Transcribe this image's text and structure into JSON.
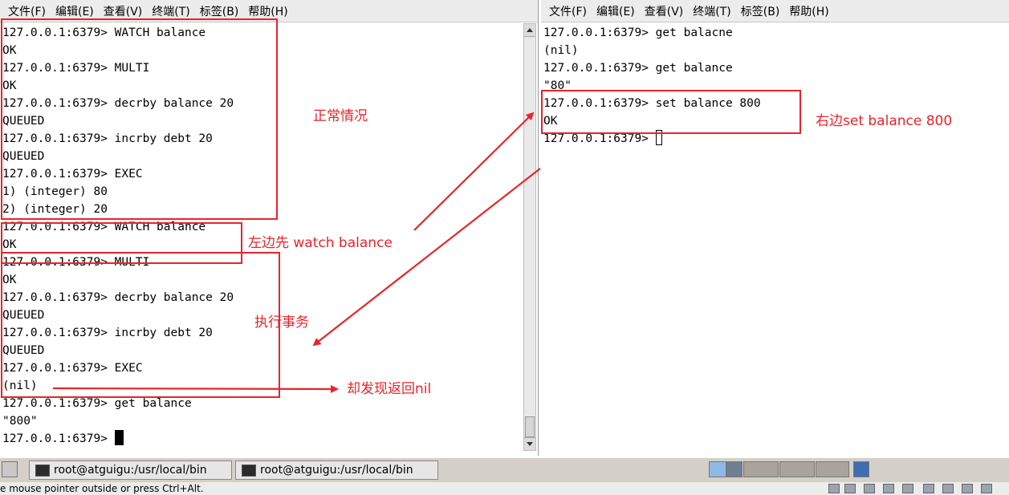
{
  "menu": [
    "文件(F)",
    "编辑(E)",
    "查看(V)",
    "终端(T)",
    "标签(B)",
    "帮助(H)"
  ],
  "left_terminal": {
    "lines": [
      "127.0.0.1:6379> WATCH balance",
      "OK",
      "127.0.0.1:6379> MULTI",
      "OK",
      "127.0.0.1:6379> decrby balance 20",
      "QUEUED",
      "127.0.0.1:6379> incrby debt 20",
      "QUEUED",
      "127.0.0.1:6379> EXEC",
      "1) (integer) 80",
      "2) (integer) 20",
      "127.0.0.1:6379> WATCH balance",
      "OK",
      "127.0.0.1:6379> MULTI",
      "OK",
      "127.0.0.1:6379> decrby balance 20",
      "QUEUED",
      "127.0.0.1:6379> incrby debt 20",
      "QUEUED",
      "127.0.0.1:6379> EXEC",
      "(nil)",
      "127.0.0.1:6379> get balance",
      "\"800\""
    ],
    "prompt": "127.0.0.1:6379> "
  },
  "right_terminal": {
    "lines": [
      "127.0.0.1:6379> get balacne",
      "(nil)",
      "127.0.0.1:6379> get balance",
      "\"80\"",
      "127.0.0.1:6379> set balance 800",
      "OK"
    ],
    "prompt": "127.0.0.1:6379> "
  },
  "annotations": {
    "normal": "正常情况",
    "left_watch": "左边先 watch balance",
    "exec_tx": "执行事务",
    "returns_nil": "却发现返回nil",
    "right_set": "右边set balance 800"
  },
  "annotation_color": "#e8242a",
  "taskbar": {
    "tasks": [
      "root@atguigu:/usr/local/bin",
      "root@atguigu:/usr/local/bin"
    ]
  },
  "statusbar": {
    "text": "e mouse pointer outside or press Ctrl+Alt."
  }
}
